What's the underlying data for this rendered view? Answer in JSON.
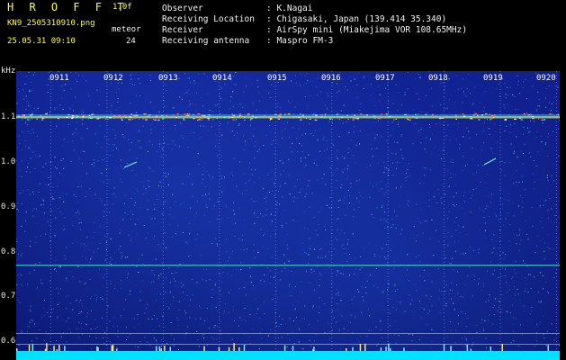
{
  "header": {
    "brand": "H R O F F T",
    "version": "1.0f",
    "filename": "KN9_2505310910.png",
    "mode": "meteor",
    "datetime": "25.05.31 09:10",
    "count": "24",
    "fields": [
      {
        "label": "Observer",
        "value": ": K.Nagai"
      },
      {
        "label": "Receiving Location",
        "value": ": Chigasaki, Japan (139.414 35.340)"
      },
      {
        "label": "Receiver",
        "value": ": AirSpy mini (Miakejima VOR 108.65MHz)"
      },
      {
        "label": "Receiving antenna",
        "value": ": Maspro FM-3"
      }
    ]
  },
  "spectrogram": {
    "y_unit": "kHz",
    "y_ticks": [
      "1.1",
      "1.0",
      "0.9",
      "0.8",
      "0.7",
      "0.6"
    ],
    "x_ticks": [
      "0911",
      "0912",
      "0913",
      "0914",
      "0915",
      "0916",
      "0917",
      "0918",
      "0919",
      "0920"
    ]
  },
  "colors": {
    "background": "#0c1a7a",
    "carrier": "#6fd4c8",
    "text_yellow": "#ffff33",
    "text_white": "#f2f2f2",
    "noise_floor": "#00e0ff"
  }
}
